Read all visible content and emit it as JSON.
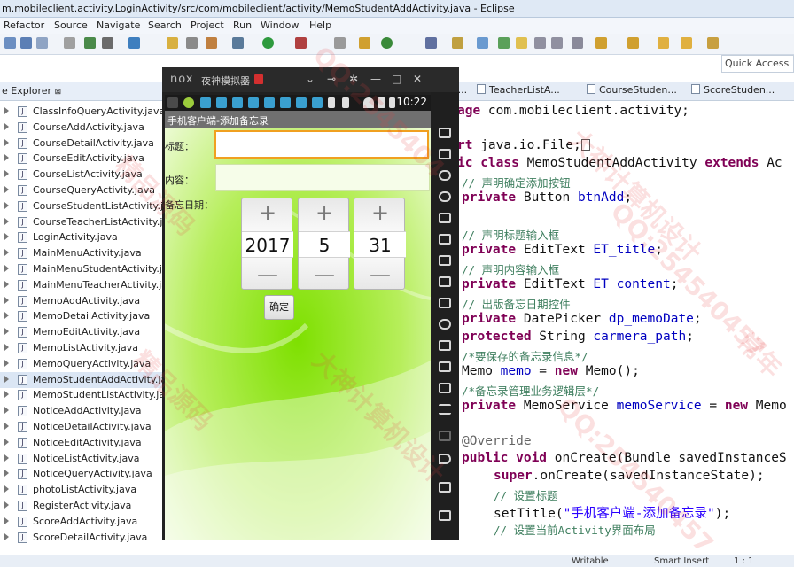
{
  "window": {
    "title": "m.mobileclient.activity.LoginActivity/src/com/mobileclient/activity/MemoStudentAddActivity.java - Eclipse"
  },
  "menu": [
    "Refactor",
    "Source",
    "Navigate",
    "Search",
    "Project",
    "Run",
    "Window",
    "Help"
  ],
  "quick_access": "Quick Access",
  "package_explorer": {
    "title": "e Explorer",
    "close": "⊠",
    "files": [
      "ClassInfoQueryActivity.java",
      "CourseAddActivity.java",
      "CourseDetailActivity.java",
      "CourseEditActivity.java",
      "CourseListActivity.java",
      "CourseQueryActivity.java",
      "CourseStudentListActivity.java",
      "CourseTeacherListActivity.java",
      "LoginActivity.java",
      "MainMenuActivity.java",
      "MainMenuStudentActivity.java",
      "MainMenuTeacherActivity.java",
      "MemoAddActivity.java",
      "MemoDetailActivity.java",
      "MemoEditActivity.java",
      "MemoListActivity.java",
      "MemoQueryActivity.java",
      "MemoStudentAddActivity.java",
      "MemoStudentListActivity.java",
      "NoticeAddActivity.java",
      "NoticeDetailActivity.java",
      "NoticeEditActivity.java",
      "NoticeListActivity.java",
      "NoticeQueryActivity.java",
      "photoListActivity.java",
      "RegisterActivity.java",
      "ScoreAddActivity.java",
      "ScoreDetailActivity.java"
    ],
    "selected_index": 17
  },
  "editor_tabs": [
    "EditA...",
    "TeacherListA...",
    "CourseStuden...",
    "ScoreStuden..."
  ],
  "code": {
    "l1_kw": "age",
    "l1_rest": " com.mobileclient.activity;",
    "l2_kw": "rt",
    "l2_rest": " java.io.File;",
    "l3_kw": "ic class",
    "l3_mid": " MemoStudentAddActivity ",
    "l3_kw2": "extends",
    "l3_rest": " Ac",
    "c1": "// 声明确定添加按钮",
    "l4_kw": "private",
    "l4_rest": " Button ",
    "l4_fld": "btnAdd",
    "l4_end": ";",
    "c2": "// 声明标题输入框",
    "l5_kw": "private",
    "l5_rest": " EditText ",
    "l5_fld": "ET_title",
    "l5_end": ";",
    "c3": "// 声明内容输入框",
    "l6_kw": "private",
    "l6_rest": " EditText ",
    "l6_fld": "ET_content",
    "l6_end": ";",
    "c4": "// 出版备忘日期控件",
    "l7_kw": "private",
    "l7_rest": " DatePicker ",
    "l7_fld": "dp_memoDate",
    "l7_end": ";",
    "l8_kw": "protected",
    "l8_rest": " String ",
    "l8_fld": "carmera_path",
    "l8_end": ";",
    "c5": "/*要保存的备忘录信息*/",
    "l9_a": "Memo ",
    "l9_fld": "memo",
    "l9_b": " = ",
    "l9_kw": "new",
    "l9_c": " Memo();",
    "c6": "/*备忘录管理业务逻辑层*/",
    "l10_kw": "private",
    "l10_rest": " MemoService ",
    "l10_fld": "memoService",
    "l10_b": " = ",
    "l10_kw2": "new",
    "l10_c": " Memo",
    "l11_ann": "@Override",
    "l12_kw": "public void",
    "l12_rest": " onCreate(Bundle savedInstanceS",
    "l13_kw": "super",
    "l13_rest": ".onCreate(savedInstanceState);",
    "c7": "// 设置标题",
    "l14_a": "setTitle(",
    "l14_str": "\"手机客户端-添加备忘录\"",
    "l14_b": ");",
    "c8": "// 设置当前Activity界面布局"
  },
  "status": {
    "writable": "Writable",
    "insert": "Smart Insert",
    "pos": "1 : 1"
  },
  "emulator": {
    "logo": "nox",
    "title": "夜神模拟器",
    "time": "10:22",
    "app_title": "手机客户端-添加备忘录",
    "title_label": "标题：",
    "title_value": "",
    "content_label": "内容：",
    "content_value": "",
    "date_label": "备忘日期：",
    "year": "2017",
    "month": "5",
    "day": "31",
    "plus": "+",
    "minus": "—",
    "ok_button": "确定"
  },
  "watermarks": [
    "QQ:2545404",
    "大神计算机设计",
    "精品源码",
    "QQ:254540457",
    "大神计算机设计",
    "精品源码",
    "常年",
    "QQ:254540457"
  ],
  "colors": {
    "accent": "#f0a020",
    "keyword": "#7f0055",
    "comment": "#3f7f5f",
    "field": "#0000c0",
    "string": "#2a00ff"
  }
}
